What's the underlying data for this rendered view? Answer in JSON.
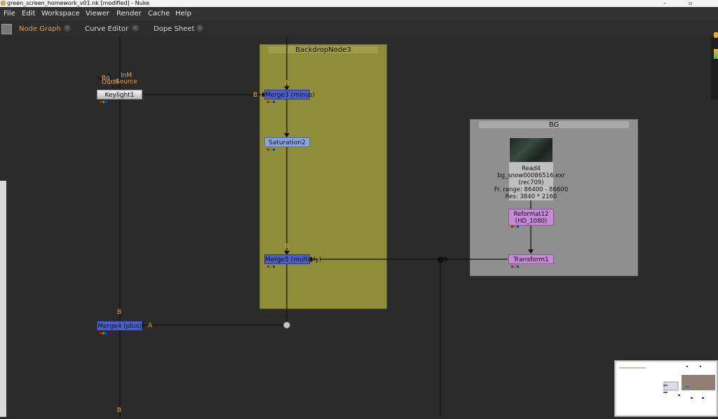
{
  "window": {
    "title": "green_screen_homework_v01.nk [modified] - Nuke",
    "controls": [
      "–",
      "▫"
    ]
  },
  "menu": [
    "File",
    "Edit",
    "Workspace",
    "Viewer",
    "Render",
    "Cache",
    "Help"
  ],
  "tabs": [
    {
      "label": "Node Graph",
      "active": true
    },
    {
      "label": "Curve Editor",
      "active": false
    },
    {
      "label": "Dope Sheet",
      "active": false
    }
  ],
  "backdrops": {
    "backdrop3": {
      "label": "BackdropNode3",
      "color": "#8d8d3a"
    },
    "bg": {
      "label": "BG",
      "color": "#8f8f8f"
    }
  },
  "nodes": {
    "keylight": {
      "label": "Keylight1"
    },
    "merge3": {
      "label": "Merge3 (minus)"
    },
    "saturation": {
      "label": "Saturation2"
    },
    "merge5": {
      "label": "Merge5 (multiply)"
    },
    "merge4": {
      "label": "Merge4 (plus)"
    },
    "read4": {
      "label": "Read4",
      "file": "bg_snow00086516.exr",
      "colorspace": "(rec709)",
      "range": "Fr. range: 86400 - 86600",
      "res": "Res: 3840 * 2160"
    },
    "reformat": {
      "label": "Reformat12",
      "sub": "(HD_1080)"
    },
    "transform": {
      "label": "Transform1"
    }
  },
  "input_labels": {
    "keylight_bg": "Bg",
    "keylight_inm": "InM",
    "keylight_outm": "OutM",
    "keylight_source": "Source",
    "merge3_a": "A",
    "merge3_b": "B",
    "merge5_a": "A",
    "merge5_b": "B",
    "merge4_a": "A",
    "merge4_b": "B",
    "bottom_b": "B"
  }
}
